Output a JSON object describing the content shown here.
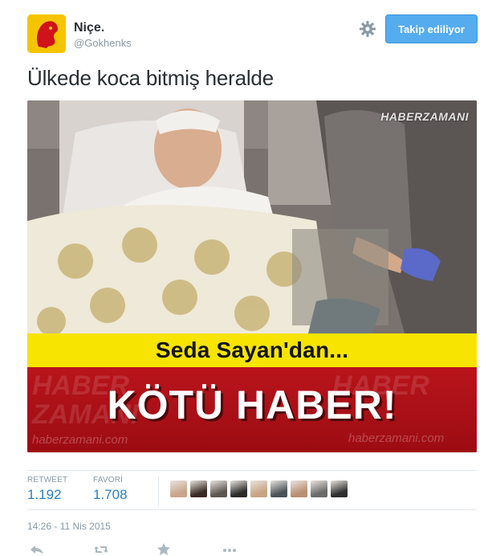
{
  "user": {
    "name": "Niçe.",
    "handle": "@Gokhenks"
  },
  "header": {
    "follow_label": "Takip ediliyor",
    "settings_icon": "gear-icon"
  },
  "tweet": {
    "text": "Ülkede koca bitmiş heralde"
  },
  "media": {
    "watermark": "HABERZAMANI",
    "banner_top": "Seda Sayan'dan...",
    "banner_headline": "KÖTÜ HABER!",
    "banner_watermark_line1": "HABER",
    "banner_watermark_line2": "ZAMANI",
    "banner_site_left": "haberzamani.com",
    "banner_site_right": "haberzamani.com",
    "banner_wm_right": "HABER"
  },
  "stats": {
    "retweet_label": "RETWEET",
    "retweet_count": "1.192",
    "favorite_label": "FAVORİ",
    "favorite_count": "1.708",
    "liker_colors": [
      "#c9a58a",
      "#3a2a24",
      "#5e5650",
      "#2b2b2b",
      "#c7a483",
      "#4a5358",
      "#b88f72",
      "#6a6a6a",
      "#2f2f2f"
    ]
  },
  "timestamp": "14:26 - 11 Nis 2015",
  "actions": {
    "reply_icon": "reply-icon",
    "retweet_icon": "retweet-icon",
    "favorite_icon": "star-icon",
    "more_icon": "more-icon"
  },
  "colors": {
    "accent": "#55acee",
    "link": "#2a7fc1",
    "banner_yellow": "#f7e400",
    "banner_red": "#b9141c",
    "avatar_bg": "#f5c400"
  }
}
